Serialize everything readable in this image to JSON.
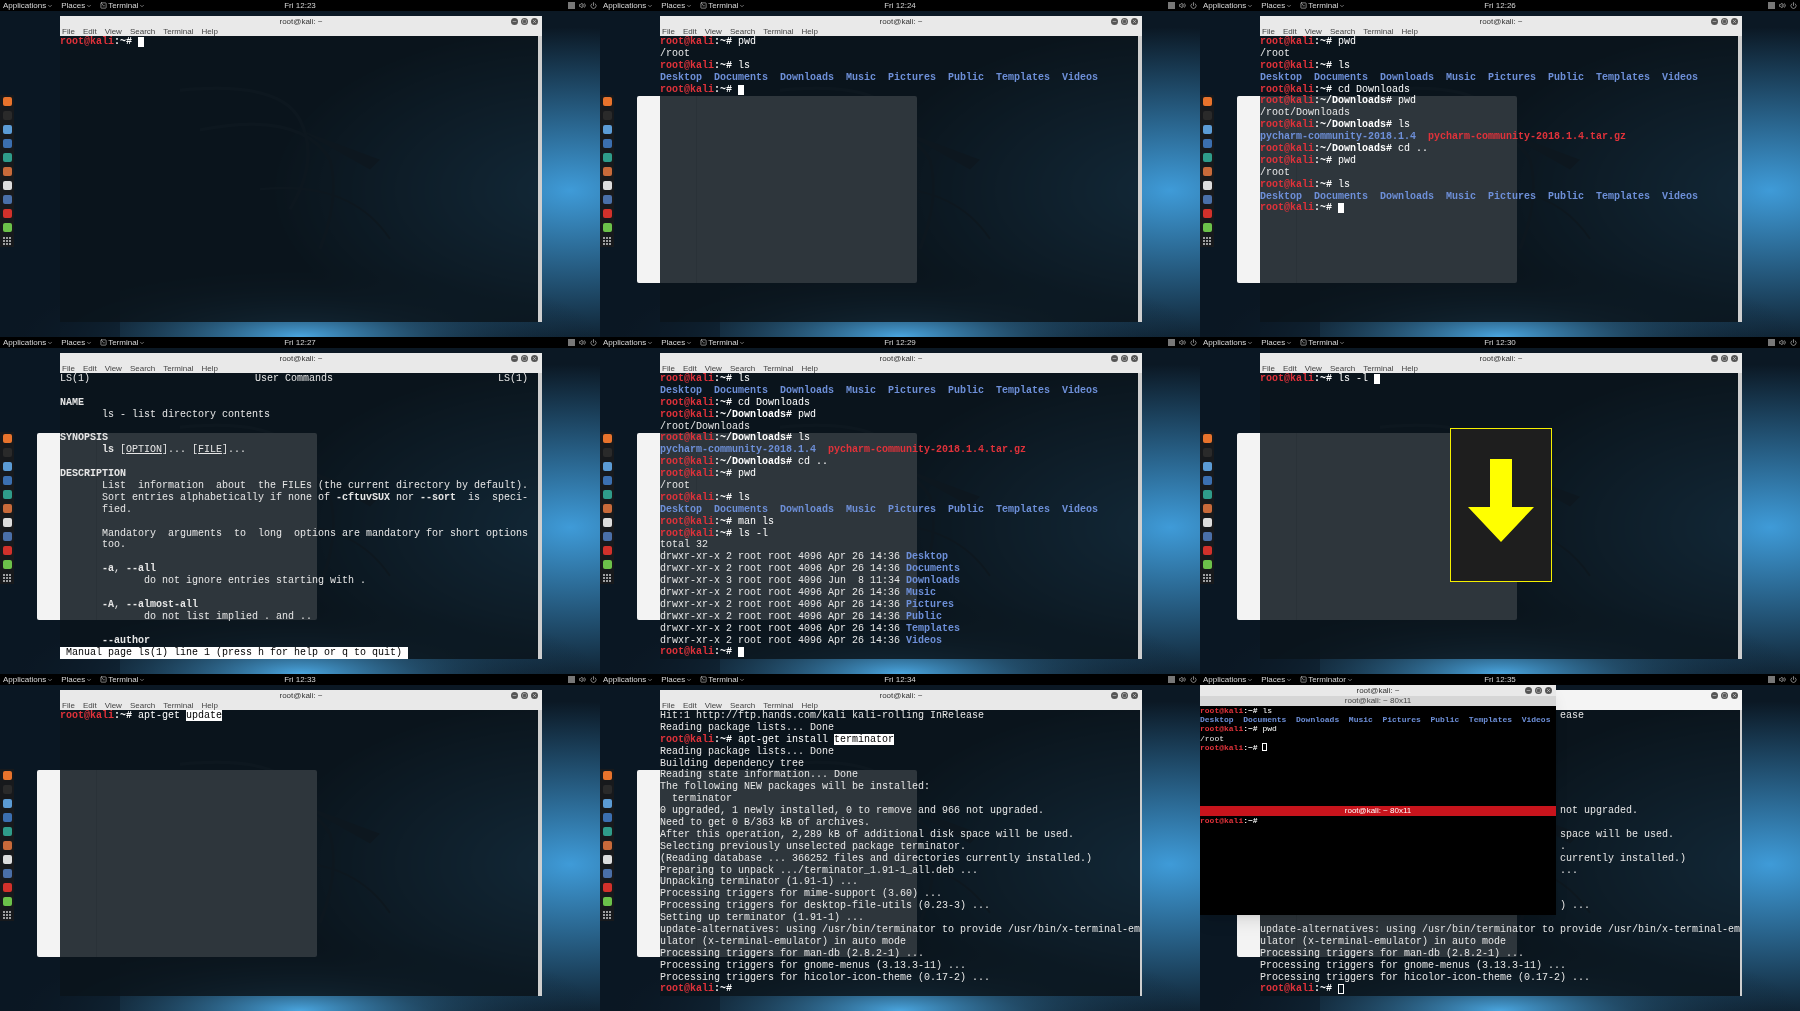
{
  "frames": [
    {
      "topbar": {
        "menus": [
          "Applications",
          "Places"
        ],
        "app": "Terminal",
        "time": "Fri 12:23"
      },
      "terminal": {
        "focused": true,
        "title": "root@kali: ~",
        "menu": [
          "File",
          "Edit",
          "View",
          "Search",
          "Terminal",
          "Help"
        ],
        "lines": [
          {
            "kind": "prompt",
            "user": "root@kali",
            "path": ":~#",
            "cursor": true
          }
        ]
      }
    },
    {
      "topbar": {
        "menus": [
          "Applications",
          "Places"
        ],
        "app": "Terminal",
        "time": "Fri 12:24"
      },
      "background_window": {
        "kind": "file-manager"
      },
      "terminal": {
        "focused": true,
        "title": "root@kali: ~",
        "menu": [
          "File",
          "Edit",
          "View",
          "Search",
          "Terminal",
          "Help"
        ],
        "lines": [
          {
            "kind": "prompt",
            "user": "root@kali",
            "path": ":~#",
            "command": "pwd"
          },
          {
            "kind": "text",
            "text": "/root"
          },
          {
            "kind": "prompt",
            "user": "root@kali",
            "path": ":~#",
            "command": "ls"
          },
          {
            "kind": "ls",
            "items": [
              {
                "text": "Desktop",
                "kind": "dir"
              },
              {
                "text": "Documents",
                "kind": "dir"
              },
              {
                "text": "Downloads",
                "kind": "dir"
              },
              {
                "text": "Music",
                "kind": "dir"
              },
              {
                "text": "Pictures",
                "kind": "dir"
              },
              {
                "text": "Public",
                "kind": "dir"
              },
              {
                "text": "Templates",
                "kind": "dir"
              },
              {
                "text": "Videos",
                "kind": "dir"
              }
            ]
          },
          {
            "kind": "prompt",
            "user": "root@kali",
            "path": ":~#",
            "cursor": true
          }
        ]
      }
    },
    {
      "topbar": {
        "menus": [
          "Applications",
          "Places"
        ],
        "app": "Terminal",
        "time": "Fri 12:26"
      },
      "background_window": {
        "kind": "file-manager"
      },
      "terminal": {
        "focused": true,
        "title": "root@kali: ~",
        "menu": [
          "File",
          "Edit",
          "View",
          "Search",
          "Terminal",
          "Help"
        ],
        "lines": [
          {
            "kind": "prompt",
            "user": "root@kali",
            "path": ":~#",
            "command": "pwd"
          },
          {
            "kind": "text",
            "text": "/root"
          },
          {
            "kind": "prompt",
            "user": "root@kali",
            "path": ":~#",
            "command": "ls"
          },
          {
            "kind": "ls",
            "items": [
              {
                "text": "Desktop",
                "kind": "dir"
              },
              {
                "text": "Documents",
                "kind": "dir"
              },
              {
                "text": "Downloads",
                "kind": "dir"
              },
              {
                "text": "Music",
                "kind": "dir"
              },
              {
                "text": "Pictures",
                "kind": "dir"
              },
              {
                "text": "Public",
                "kind": "dir"
              },
              {
                "text": "Templates",
                "kind": "dir"
              },
              {
                "text": "Videos",
                "kind": "dir"
              }
            ]
          },
          {
            "kind": "prompt",
            "user": "root@kali",
            "path": ":~#",
            "command": "cd Downloads"
          },
          {
            "kind": "prompt",
            "user": "root@kali",
            "path": ":~/Downloads#",
            "command": "pwd"
          },
          {
            "kind": "text",
            "text": "/root/Downloads"
          },
          {
            "kind": "prompt",
            "user": "root@kali",
            "path": ":~/Downloads#",
            "command": "ls"
          },
          {
            "kind": "ls",
            "items": [
              {
                "text": "pycharm-community-2018.1.4",
                "kind": "dir"
              },
              {
                "text": "pycharm-community-2018.1.4.tar.gz",
                "kind": "archive"
              }
            ]
          },
          {
            "kind": "prompt",
            "user": "root@kali",
            "path": ":~/Downloads#",
            "command": "cd .."
          },
          {
            "kind": "prompt",
            "user": "root@kali",
            "path": ":~#",
            "command": "pwd"
          },
          {
            "kind": "text",
            "text": "/root"
          },
          {
            "kind": "prompt",
            "user": "root@kali",
            "path": ":~#",
            "command": "ls"
          },
          {
            "kind": "ls",
            "items": [
              {
                "text": "Desktop",
                "kind": "dir"
              },
              {
                "text": "Documents",
                "kind": "dir"
              },
              {
                "text": "Downloads",
                "kind": "dir"
              },
              {
                "text": "Music",
                "kind": "dir"
              },
              {
                "text": "Pictures",
                "kind": "dir"
              },
              {
                "text": "Public",
                "kind": "dir"
              },
              {
                "text": "Templates",
                "kind": "dir"
              },
              {
                "text": "Videos",
                "kind": "dir"
              }
            ]
          },
          {
            "kind": "prompt",
            "user": "root@kali",
            "path": ":~#",
            "cursor": true
          }
        ]
      }
    },
    {
      "topbar": {
        "menus": [
          "Applications",
          "Places"
        ],
        "app": "Terminal",
        "time": "Fri 12:27"
      },
      "background_window": {
        "kind": "file-manager"
      },
      "terminal": {
        "focused": true,
        "title": "root@kali: ~",
        "menu": [
          "File",
          "Edit",
          "View",
          "Search",
          "Terminal",
          "Help"
        ],
        "man": {
          "header": [
            "LS(1)",
            "User Commands",
            "LS(1)"
          ],
          "sections": [
            {
              "lines": [
                [
                  {
                    "t": "NAME",
                    "bold": true
                  }
                ]
              ],
              "children": [
                {
                  "lines": [
                    [
                      {
                        "t": "ls - list directory contents"
                      }
                    ]
                  ]
                }
              ]
            },
            {
              "lines": [
                [
                  {
                    "t": "SYNOPSIS",
                    "bold": true
                  }
                ]
              ],
              "children": [
                {
                  "lines": [
                    [
                      {
                        "t": "ls",
                        "bold": true
                      },
                      {
                        "t": " ["
                      },
                      {
                        "t": "OPTION",
                        "underline": true
                      },
                      {
                        "t": "]... ["
                      },
                      {
                        "t": "FILE",
                        "underline": true
                      },
                      {
                        "t": "]..."
                      }
                    ]
                  ]
                }
              ]
            },
            {
              "lines": [
                [
                  {
                    "t": "DESCRIPTION",
                    "bold": true
                  }
                ]
              ],
              "children": [
                {
                  "lines": [
                    [
                      {
                        "t": "List  information  about  the FILEs (the current directory by default)."
                      }
                    ],
                    [
                      {
                        "t": "Sort entries alphabetically if none of "
                      },
                      {
                        "t": "-cftuvSUX",
                        "bold": true
                      },
                      {
                        "t": " nor "
                      },
                      {
                        "t": "--sort",
                        "bold": true
                      },
                      {
                        "t": "  is  speci-"
                      }
                    ],
                    [
                      {
                        "t": "fied."
                      }
                    ]
                  ]
                },
                {
                  "lines": [
                    [
                      {
                        "t": "Mandatory  arguments  to  long  options are mandatory for short options"
                      }
                    ],
                    [
                      {
                        "t": "too."
                      }
                    ]
                  ]
                },
                {
                  "lines": [
                    [
                      {
                        "t": "-a",
                        "bold": true
                      },
                      {
                        "t": ", "
                      },
                      {
                        "t": "--all",
                        "bold": true
                      }
                    ]
                  ],
                  "children": [
                    {
                      "lines": [
                        [
                          {
                            "t": "do not ignore entries starting with ."
                          }
                        ]
                      ]
                    }
                  ]
                },
                {
                  "lines": [
                    [
                      {
                        "t": "-A",
                        "bold": true
                      },
                      {
                        "t": ", "
                      },
                      {
                        "t": "--almost-all",
                        "bold": true
                      }
                    ]
                  ],
                  "children": [
                    {
                      "lines": [
                        [
                          {
                            "t": "do not list implied . and .."
                          }
                        ]
                      ]
                    }
                  ]
                },
                {
                  "lines": [
                    [
                      {
                        "t": "--author",
                        "bold": true
                      }
                    ]
                  ]
                }
              ]
            }
          ],
          "status": "Manual page ls(1) line 1 (press h for help or q to quit)"
        }
      }
    },
    {
      "topbar": {
        "menus": [
          "Applications",
          "Places"
        ],
        "app": "Terminal",
        "time": "Fri 12:29"
      },
      "background_window": {
        "kind": "file-manager"
      },
      "terminal": {
        "focused": true,
        "title": "root@kali: ~",
        "menu": [
          "File",
          "Edit",
          "View",
          "Search",
          "Terminal",
          "Help"
        ],
        "lines": [
          {
            "kind": "prompt",
            "user": "root@kali",
            "path": ":~#",
            "command": "ls"
          },
          {
            "kind": "ls",
            "items": [
              {
                "text": "Desktop",
                "kind": "dir"
              },
              {
                "text": "Documents",
                "kind": "dir"
              },
              {
                "text": "Downloads",
                "kind": "dir"
              },
              {
                "text": "Music",
                "kind": "dir"
              },
              {
                "text": "Pictures",
                "kind": "dir"
              },
              {
                "text": "Public",
                "kind": "dir"
              },
              {
                "text": "Templates",
                "kind": "dir"
              },
              {
                "text": "Videos",
                "kind": "dir"
              }
            ]
          },
          {
            "kind": "prompt",
            "user": "root@kali",
            "path": ":~#",
            "command": "cd Downloads"
          },
          {
            "kind": "prompt",
            "user": "root@kali",
            "path": ":~/Downloads#",
            "command": "pwd"
          },
          {
            "kind": "text",
            "text": "/root/Downloads"
          },
          {
            "kind": "prompt",
            "user": "root@kali",
            "path": ":~/Downloads#",
            "command": "ls"
          },
          {
            "kind": "ls",
            "items": [
              {
                "text": "pycharm-community-2018.1.4",
                "kind": "dir"
              },
              {
                "text": "pycharm-community-2018.1.4.tar.gz",
                "kind": "archive"
              }
            ]
          },
          {
            "kind": "prompt",
            "user": "root@kali",
            "path": ":~/Downloads#",
            "command": "cd .."
          },
          {
            "kind": "prompt",
            "user": "root@kali",
            "path": ":~#",
            "command": "pwd"
          },
          {
            "kind": "text",
            "text": "/root"
          },
          {
            "kind": "prompt",
            "user": "root@kali",
            "path": ":~#",
            "command": "ls"
          },
          {
            "kind": "ls",
            "items": [
              {
                "text": "Desktop",
                "kind": "dir"
              },
              {
                "text": "Documents",
                "kind": "dir"
              },
              {
                "text": "Downloads",
                "kind": "dir"
              },
              {
                "text": "Music",
                "kind": "dir"
              },
              {
                "text": "Pictures",
                "kind": "dir"
              },
              {
                "text": "Public",
                "kind": "dir"
              },
              {
                "text": "Templates",
                "kind": "dir"
              },
              {
                "text": "Videos",
                "kind": "dir"
              }
            ]
          },
          {
            "kind": "prompt",
            "user": "root@kali",
            "path": ":~#",
            "command": "man ls"
          },
          {
            "kind": "prompt",
            "user": "root@kali",
            "path": ":~#",
            "command": "ls -l"
          },
          {
            "kind": "text",
            "text": "total 32"
          },
          {
            "kind": "long",
            "info": "drwxr-xr-x 2 root root 4096 Apr 26 14:36",
            "name": "Desktop"
          },
          {
            "kind": "long",
            "info": "drwxr-xr-x 2 root root 4096 Apr 26 14:36",
            "name": "Documents"
          },
          {
            "kind": "long",
            "info": "drwxr-xr-x 3 root root 4096 Jun  8 11:34",
            "name": "Downloads"
          },
          {
            "kind": "long",
            "info": "drwxr-xr-x 2 root root 4096 Apr 26 14:36",
            "name": "Music"
          },
          {
            "kind": "long",
            "info": "drwxr-xr-x 2 root root 4096 Apr 26 14:36",
            "name": "Pictures"
          },
          {
            "kind": "long",
            "info": "drwxr-xr-x 2 root root 4096 Apr 26 14:36",
            "name": "Public"
          },
          {
            "kind": "long",
            "info": "drwxr-xr-x 2 root root 4096 Apr 26 14:36",
            "name": "Templates"
          },
          {
            "kind": "long",
            "info": "drwxr-xr-x 2 root root 4096 Apr 26 14:36",
            "name": "Videos"
          },
          {
            "kind": "prompt",
            "user": "root@kali",
            "path": ":~#",
            "cursor": true
          }
        ]
      }
    },
    {
      "topbar": {
        "menus": [
          "Applications",
          "Places"
        ],
        "app": "Terminal",
        "time": "Fri 12:30"
      },
      "background_window": {
        "kind": "file-manager"
      },
      "annotation": {
        "kind": "arrow-down"
      },
      "terminal": {
        "focused": true,
        "title": "root@kali: ~",
        "menu": [
          "File",
          "Edit",
          "View",
          "Search",
          "Terminal",
          "Help"
        ],
        "lines": [
          {
            "kind": "prompt",
            "user": "root@kali",
            "path": ":~#",
            "command": "ls -l",
            "cursor": true
          }
        ]
      }
    },
    {
      "topbar": {
        "menus": [
          "Applications",
          "Places"
        ],
        "app": "Terminal",
        "time": "Fri 12:33"
      },
      "background_window": {
        "kind": "file-manager"
      },
      "terminal": {
        "focused": true,
        "title": "root@kali: ~",
        "menu": [
          "File",
          "Edit",
          "View",
          "Search",
          "Terminal",
          "Help"
        ],
        "lines": [
          {
            "kind": "prompt",
            "user": "root@kali",
            "path": ":~#",
            "command": "apt-get",
            "selection": "update"
          }
        ]
      }
    },
    {
      "topbar": {
        "menus": [
          "Applications",
          "Places"
        ],
        "app": "Terminal",
        "time": "Fri 12:34"
      },
      "background_window": {
        "kind": "file-manager"
      },
      "terminal": {
        "focused": true,
        "title": "root@kali: ~",
        "menu": [
          "File",
          "Edit",
          "View",
          "Search",
          "Terminal",
          "Help"
        ],
        "lines": [
          {
            "kind": "text",
            "text": "Hit:1 http://ftp.hands.com/kali kali-rolling InRelease"
          },
          {
            "kind": "text",
            "text": "Reading package lists... Done"
          },
          {
            "kind": "prompt",
            "user": "root@kali",
            "path": ":~#",
            "command": "apt-get install",
            "selection": "terminator"
          },
          {
            "kind": "text",
            "text": "Reading package lists... Done"
          },
          {
            "kind": "text",
            "text": "Building dependency tree"
          },
          {
            "kind": "text",
            "text": "Reading state information... Done"
          },
          {
            "kind": "text",
            "text": "The following NEW packages will be installed:"
          },
          {
            "kind": "text",
            "text": "  terminator"
          },
          {
            "kind": "text",
            "text": "0 upgraded, 1 newly installed, 0 to remove and 966 not upgraded."
          },
          {
            "kind": "text",
            "text": "Need to get 0 B/363 kB of archives."
          },
          {
            "kind": "text",
            "text": "After this operation, 2,289 kB of additional disk space will be used."
          },
          {
            "kind": "text",
            "text": "Selecting previously unselected package terminator."
          },
          {
            "kind": "text",
            "text": "(Reading database ... 366252 files and directories currently installed.)"
          },
          {
            "kind": "text",
            "text": "Preparing to unpack .../terminator_1.91-1_all.deb ..."
          },
          {
            "kind": "text",
            "text": "Unpacking terminator (1.91-1) ..."
          },
          {
            "kind": "text",
            "text": "Processing triggers for mime-support (3.60) ..."
          },
          {
            "kind": "text",
            "text": "Processing triggers for desktop-file-utils (0.23-3) ..."
          },
          {
            "kind": "text",
            "text": "Setting up terminator (1.91-1) ..."
          },
          {
            "kind": "text",
            "text": "update-alternatives: using /usr/bin/terminator to provide /usr/bin/x-terminal-em"
          },
          {
            "kind": "text",
            "text": "ulator (x-terminal-emulator) in auto mode"
          },
          {
            "kind": "text",
            "text": "Processing triggers for man-db (2.8.2-1) ..."
          },
          {
            "kind": "text",
            "text": "Processing triggers for gnome-menus (3.13.3-11) ..."
          },
          {
            "kind": "text",
            "text": "Processing triggers for hicolor-icon-theme (0.17-2) ..."
          },
          {
            "kind": "prompt",
            "user": "root@kali",
            "path": ":~#"
          }
        ]
      }
    },
    {
      "topbar": {
        "menus": [
          "Applications",
          "Places"
        ],
        "app": "Terminator",
        "time": "Fri 12:35"
      },
      "background_window": {
        "kind": "file-manager"
      },
      "terminal": {
        "focused": false,
        "lines": [
          {
            "kind": "covered",
            "text": "ease"
          },
          {
            "kind": "blank"
          },
          {
            "kind": "blank"
          },
          {
            "kind": "blank"
          },
          {
            "kind": "blank"
          },
          {
            "kind": "blank"
          },
          {
            "kind": "blank"
          },
          {
            "kind": "blank"
          },
          {
            "kind": "covered",
            "text": "not upgraded."
          },
          {
            "kind": "blank"
          },
          {
            "kind": "covered",
            "text": "space will be used."
          },
          {
            "kind": "covered",
            "text": "."
          },
          {
            "kind": "covered",
            "text": "currently installed.)"
          },
          {
            "kind": "covered",
            "text": "..."
          },
          {
            "kind": "blank"
          },
          {
            "kind": "blank"
          },
          {
            "kind": "covered",
            "text": ") ..."
          },
          {
            "kind": "blank"
          },
          {
            "kind": "text",
            "text": "update-alternatives: using /usr/bin/terminator to provide /usr/bin/x-terminal-em"
          },
          {
            "kind": "text",
            "text": "ulator (x-terminal-emulator) in auto mode"
          },
          {
            "kind": "text",
            "text": "Processing triggers for man-db (2.8.2-1) ..."
          },
          {
            "kind": "text",
            "text": "Processing triggers for gnome-menus (3.13.3-11) ..."
          },
          {
            "kind": "text",
            "text": "Processing triggers for hicolor-icon-theme (0.17-2) ..."
          },
          {
            "kind": "prompt",
            "user": "root@kali",
            "path": ":~#",
            "cursor": true
          }
        ]
      },
      "terminator": {
        "title": "root@kali: ~",
        "panes": [
          {
            "title": "root@kali: ~ 80x11",
            "active": false,
            "lines": [
              {
                "kind": "prompt",
                "user": "root@kali",
                "path": ":~#",
                "command": "ls"
              },
              {
                "kind": "ls",
                "items": [
                  {
                    "text": "Desktop",
                    "kind": "dir"
                  },
                  {
                    "text": "Documents",
                    "kind": "dir"
                  },
                  {
                    "text": "Downloads",
                    "kind": "dir"
                  },
                  {
                    "text": "Music",
                    "kind": "dir"
                  },
                  {
                    "text": "Pictures",
                    "kind": "dir"
                  },
                  {
                    "text": "Public",
                    "kind": "dir"
                  },
                  {
                    "text": "Templates",
                    "kind": "dir"
                  },
                  {
                    "text": "Videos",
                    "kind": "dir"
                  }
                ]
              },
              {
                "kind": "prompt",
                "user": "root@kali",
                "path": ":~#",
                "command": "pwd"
              },
              {
                "kind": "text",
                "text": "/root"
              },
              {
                "kind": "prompt",
                "user": "root@kali",
                "path": ":~#",
                "cursor": true
              }
            ]
          },
          {
            "title": "root@kali: ~ 80x11",
            "active": true,
            "lines": [
              {
                "kind": "prompt",
                "user": "root@kali",
                "path": ":~#"
              }
            ]
          }
        ]
      }
    }
  ]
}
